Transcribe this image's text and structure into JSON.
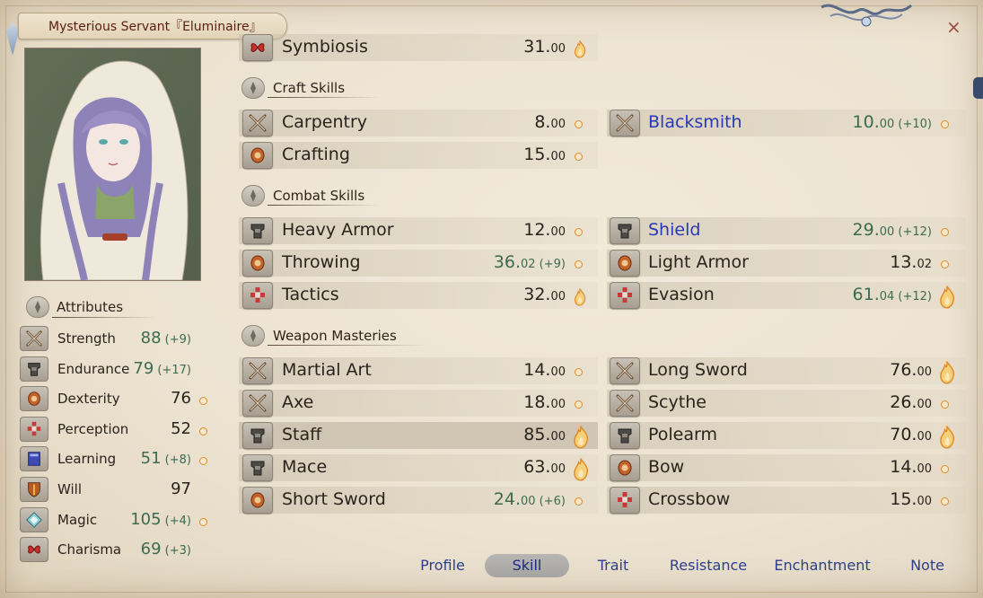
{
  "window": {
    "title": "Mysterious Servant『Eluminaire』",
    "close_label": "×"
  },
  "skills_top": [
    {
      "name": "Symbiosis",
      "value": "31.",
      "dec": "00",
      "bonus": "",
      "blue": false,
      "green": false,
      "potential": "flame-small",
      "icon": "charisma-icon"
    }
  ],
  "sections": [
    {
      "title": "Craft Skills",
      "rows": [
        [
          {
            "name": "Carpentry",
            "value": "8.",
            "dec": "00",
            "bonus": "",
            "blue": false,
            "green": false,
            "potential": "dot",
            "icon": "swords-icon"
          },
          {
            "name": "Blacksmith",
            "value": "10.",
            "dec": "00",
            "bonus": " (+10)",
            "blue": true,
            "green": true,
            "potential": "dot",
            "icon": "swords-icon"
          }
        ],
        [
          {
            "name": "Crafting",
            "value": "15.",
            "dec": "00",
            "bonus": "",
            "blue": false,
            "green": false,
            "potential": "dot",
            "icon": "dexterity-icon"
          }
        ]
      ]
    },
    {
      "title": "Combat Skills",
      "rows": [
        [
          {
            "name": "Heavy Armor",
            "value": "12.",
            "dec": "00",
            "bonus": "",
            "blue": false,
            "green": false,
            "potential": "dot",
            "icon": "armor-icon"
          },
          {
            "name": "Shield",
            "value": "29.",
            "dec": "00",
            "bonus": " (+12)",
            "blue": true,
            "green": true,
            "potential": "dot",
            "icon": "armor-icon"
          }
        ],
        [
          {
            "name": "Throwing",
            "value": "36.",
            "dec": "02",
            "bonus": " (+9)",
            "blue": false,
            "green": true,
            "potential": "dot",
            "icon": "dexterity-icon"
          },
          {
            "name": "Light Armor",
            "value": "13.",
            "dec": "02",
            "bonus": "",
            "blue": false,
            "green": false,
            "potential": "dot",
            "icon": "dexterity-icon"
          }
        ],
        [
          {
            "name": "Tactics",
            "value": "32.",
            "dec": "00",
            "bonus": "",
            "blue": false,
            "green": false,
            "potential": "flame-small",
            "icon": "perception-icon"
          },
          {
            "name": "Evasion",
            "value": "61.",
            "dec": "04",
            "bonus": " (+12)",
            "blue": false,
            "green": true,
            "potential": "flame",
            "icon": "perception-icon"
          }
        ]
      ]
    },
    {
      "title": "Weapon Masteries",
      "rows": [
        [
          {
            "name": "Martial Art",
            "value": "14.",
            "dec": "00",
            "bonus": "",
            "blue": false,
            "green": false,
            "potential": "dot",
            "icon": "swords-icon"
          },
          {
            "name": "Long Sword",
            "value": "76.",
            "dec": "00",
            "bonus": "",
            "blue": false,
            "green": false,
            "potential": "flame",
            "icon": "swords-icon"
          }
        ],
        [
          {
            "name": "Axe",
            "value": "18.",
            "dec": "00",
            "bonus": "",
            "blue": false,
            "green": false,
            "potential": "dot",
            "icon": "swords-icon"
          },
          {
            "name": "Scythe",
            "value": "26.",
            "dec": "00",
            "bonus": "",
            "blue": false,
            "green": false,
            "potential": "dot",
            "icon": "swords-icon"
          }
        ],
        [
          {
            "name": "Staff",
            "value": "85.",
            "dec": "00",
            "bonus": "",
            "blue": false,
            "green": false,
            "potential": "flame",
            "icon": "armor-icon",
            "selected": true
          },
          {
            "name": "Polearm",
            "value": "70.",
            "dec": "00",
            "bonus": "",
            "blue": false,
            "green": false,
            "potential": "flame",
            "icon": "armor-icon"
          }
        ],
        [
          {
            "name": "Mace",
            "value": "63.",
            "dec": "00",
            "bonus": "",
            "blue": false,
            "green": false,
            "potential": "flame",
            "icon": "armor-icon"
          },
          {
            "name": "Bow",
            "value": "14.",
            "dec": "00",
            "bonus": "",
            "blue": false,
            "green": false,
            "potential": "dot",
            "icon": "dexterity-icon"
          }
        ],
        [
          {
            "name": "Short Sword",
            "value": "24.",
            "dec": "00",
            "bonus": " (+6)",
            "blue": false,
            "green": true,
            "potential": "dot",
            "icon": "dexterity-icon"
          },
          {
            "name": "Crossbow",
            "value": "15.",
            "dec": "00",
            "bonus": "",
            "blue": false,
            "green": false,
            "potential": "dot",
            "icon": "perception-icon"
          }
        ]
      ]
    }
  ],
  "attributes": {
    "title": "Attributes",
    "items": [
      {
        "name": "Strength",
        "value": "88",
        "bonus": " (+9)",
        "green": true,
        "potential": "",
        "icon": "swords-icon"
      },
      {
        "name": "Endurance",
        "value": "79",
        "bonus": " (+17)",
        "green": true,
        "potential": "",
        "icon": "armor-icon"
      },
      {
        "name": "Dexterity",
        "value": "76",
        "bonus": "",
        "green": false,
        "potential": "dot",
        "icon": "dexterity-icon"
      },
      {
        "name": "Perception",
        "value": "52",
        "bonus": "",
        "green": false,
        "potential": "dot",
        "icon": "perception-icon"
      },
      {
        "name": "Learning",
        "value": "51",
        "bonus": " (+8)",
        "green": true,
        "potential": "dot",
        "icon": "book-icon"
      },
      {
        "name": "Will",
        "value": "97",
        "bonus": "",
        "green": false,
        "potential": "",
        "icon": "shield-crest-icon"
      },
      {
        "name": "Magic",
        "value": "105",
        "bonus": " (+4)",
        "green": true,
        "potential": "dot",
        "icon": "magic-icon"
      },
      {
        "name": "Charisma",
        "value": "69",
        "bonus": " (+3)",
        "green": true,
        "potential": "",
        "icon": "charisma-icon"
      }
    ]
  },
  "tabs": [
    {
      "label": "Profile",
      "active": false
    },
    {
      "label": "Skill",
      "active": true
    },
    {
      "label": "Trait",
      "active": false
    },
    {
      "label": "Resistance",
      "active": false
    },
    {
      "label": "Enchantment",
      "active": false
    },
    {
      "label": "Note",
      "active": false
    }
  ]
}
